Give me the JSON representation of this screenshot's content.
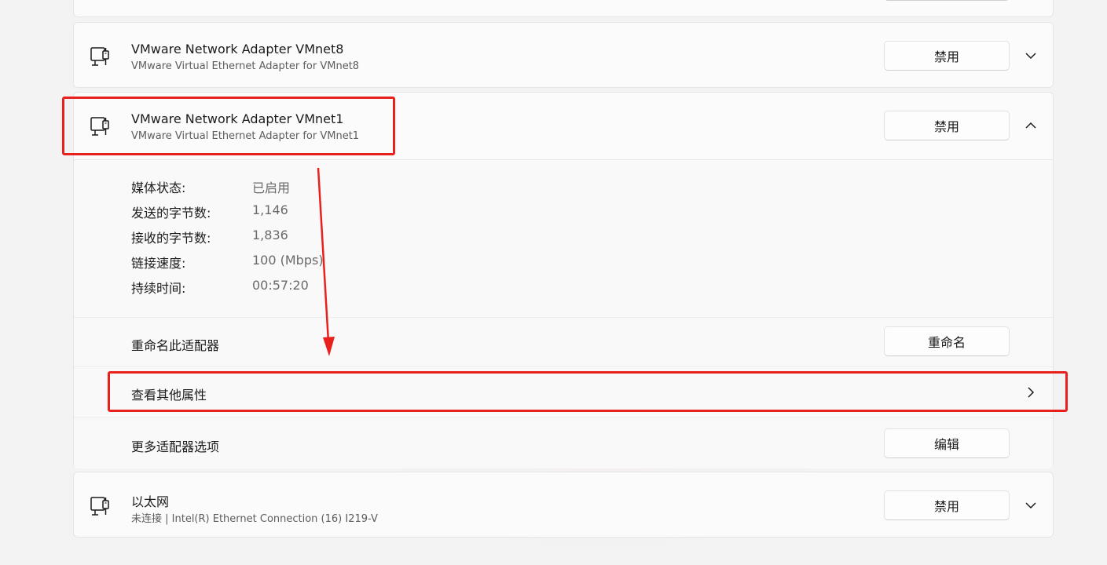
{
  "top_card": {
    "button_label": ""
  },
  "adapters": [
    {
      "name": "VMware Network Adapter VMnet8",
      "description": "VMware Virtual Ethernet Adapter for VMnet8",
      "button_label": "禁用",
      "icon": "network-adapter-icon",
      "expanded": false
    },
    {
      "name": "VMware Network Adapter VMnet1",
      "description": "VMware Virtual Ethernet Adapter for VMnet1",
      "button_label": "禁用",
      "icon": "network-adapter-icon",
      "expanded": true,
      "details": [
        {
          "label": "媒体状态:",
          "value": "已启用"
        },
        {
          "label": "发送的字节数:",
          "value": "1,146"
        },
        {
          "label": "接收的字节数:",
          "value": "1,836"
        },
        {
          "label": "链接速度:",
          "value": "100 (Mbps)"
        },
        {
          "label": "持续时间:",
          "value": "00:57:20"
        }
      ],
      "settings": {
        "rename_label": "重命名此适配器",
        "rename_button": "重命名",
        "more_properties_label": "查看其他属性",
        "more_options_label": "更多适配器选项",
        "edit_button": "编辑"
      }
    },
    {
      "name": "以太网",
      "description": "未连接 | Intel(R) Ethernet Connection (16) I219-V",
      "button_label": "禁用",
      "icon": "network-adapter-icon",
      "expanded": false
    }
  ],
  "annotations": {
    "highlight_color": "#e8201e",
    "arrow_color": "#e8201e"
  }
}
